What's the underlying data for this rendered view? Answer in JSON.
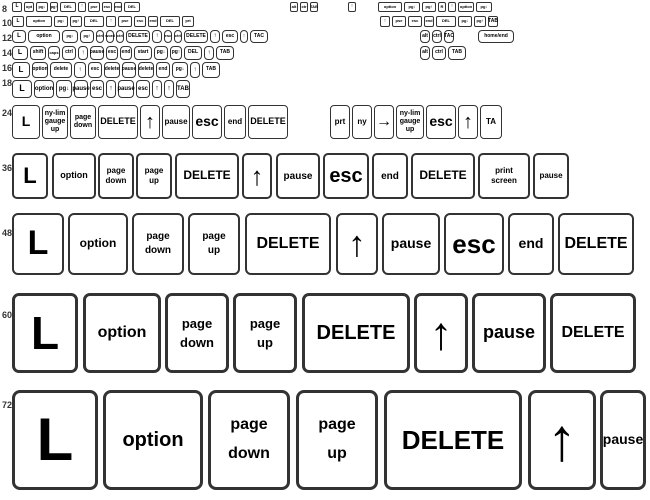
{
  "rows": {
    "r8": "8",
    "r10": "10",
    "r12": "12",
    "r14": "14",
    "r16": "16",
    "r18": "18",
    "r24": "24",
    "r36": "36",
    "r48": "48",
    "r60": "60",
    "r72": "72"
  },
  "keys": {
    "L": "L",
    "option": "option",
    "page_down": "page\ndown",
    "page_up": "page\nup",
    "DELETE": "DELETE",
    "arrow_up": "↑",
    "pause": "pause",
    "esc": "esc",
    "end": "end",
    "print_screen": "print\nscreen",
    "arrow_right": "→",
    "TAB": "TAB",
    "tab": "tab",
    "ctrl": "ctrl",
    "caps": "caps",
    "shift": "shift",
    "alt": "alt"
  }
}
